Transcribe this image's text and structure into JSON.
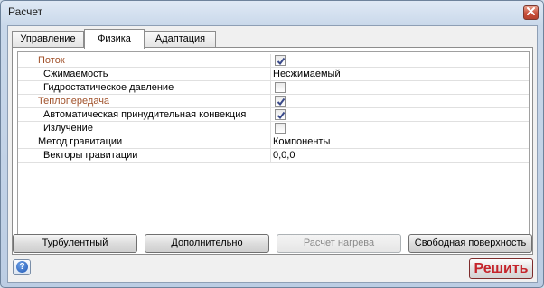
{
  "window": {
    "title": "Расчет"
  },
  "tabs": [
    {
      "label": "Управление",
      "active": false
    },
    {
      "label": "Физика",
      "active": true
    },
    {
      "label": "Адаптация",
      "active": false
    }
  ],
  "properties": [
    {
      "label": "Поток",
      "kind": "category",
      "checked": true
    },
    {
      "label": "Сжимаемость",
      "kind": "item",
      "value": "Несжимаемый"
    },
    {
      "label": "Гидростатическое давление",
      "kind": "item",
      "checked": false
    },
    {
      "label": "Теплопередача",
      "kind": "category",
      "checked": true
    },
    {
      "label": "Автоматическая принудительная конвекция",
      "kind": "item",
      "checked": true
    },
    {
      "label": "Излучение",
      "kind": "item",
      "checked": false
    },
    {
      "label": "Метод гравитации",
      "kind": "item",
      "value": "Компоненты"
    },
    {
      "label": "Векторы гравитации",
      "kind": "item",
      "value": "0,0,0"
    }
  ],
  "buttons": {
    "turbulent": "Турбулентный",
    "advanced": "Дополнительно",
    "heat_calc": "Расчет нагрева",
    "free_surface": "Свободная поверхность",
    "solve": "Решить"
  },
  "colors": {
    "category_text": "#a0512a",
    "solve_text": "#c5242b",
    "checkmark": "#3a4a8a"
  },
  "icons": {
    "close": "close-icon",
    "help": "help-icon",
    "check": "checkmark-icon"
  }
}
